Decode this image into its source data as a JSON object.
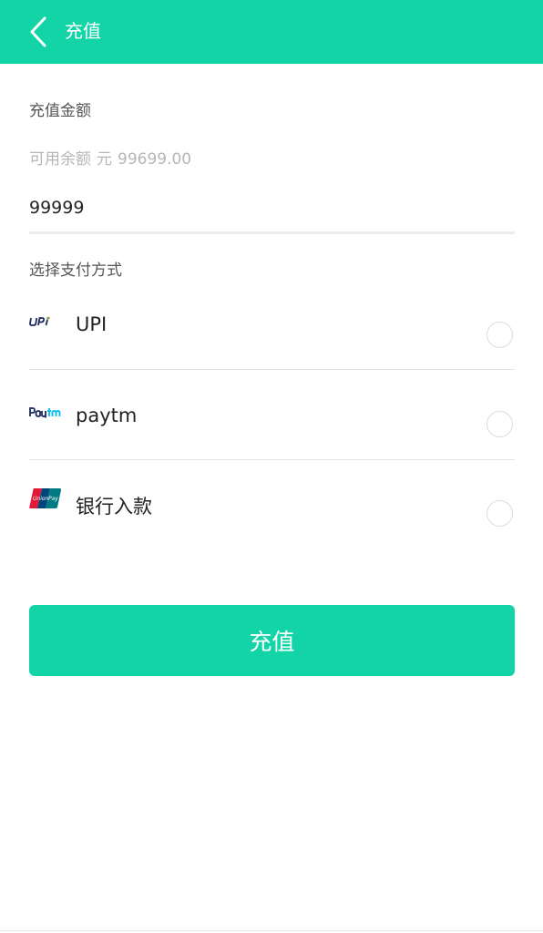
{
  "header": {
    "back_icon": "chevron-left-icon",
    "title": "充值",
    "background_color": "#12d4a6"
  },
  "amount_section": {
    "label": "充值金额",
    "balance_label": "可用余额",
    "balance_currency": "元",
    "balance_value": "99699.00",
    "input_value": "99999"
  },
  "payment_section": {
    "label": "选择支付方式",
    "methods": [
      {
        "icon": "upi-logo-icon",
        "label": "UPI",
        "selected": false
      },
      {
        "icon": "paytm-logo-icon",
        "label": "paytm",
        "selected": false
      },
      {
        "icon": "unionpay-logo-icon",
        "label": "银行入款",
        "selected": false
      }
    ]
  },
  "submit_button": {
    "label": "充值"
  }
}
